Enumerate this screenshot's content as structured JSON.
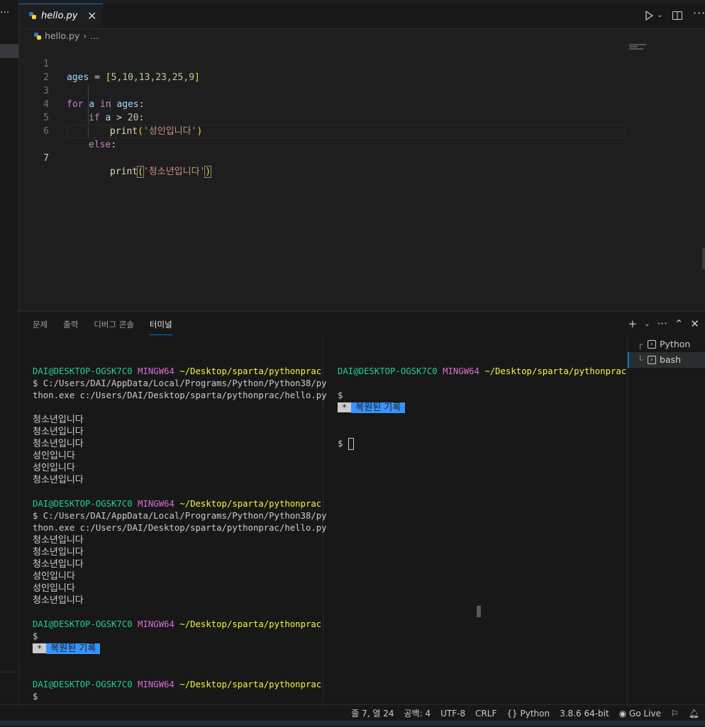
{
  "editor": {
    "tab_label": "hello.py",
    "breadcrumb_file": "hello.py",
    "breadcrumb_more": "...",
    "line_numbers": [
      "1",
      "2",
      "3",
      "4",
      "5",
      "6",
      "7"
    ],
    "code": {
      "l1_var": "ages",
      "l1_eq": " = ",
      "l1_open": "[",
      "l1_nums": "5,10,13,23,25,9",
      "l1_close": "]",
      "l3_for": "for",
      "l3_a": " a ",
      "l3_in": "in",
      "l3_ages": " ages",
      "l3_colon": ":",
      "l4_if": "if",
      "l4_a": " a ",
      "l4_gt": "> ",
      "l4_num": "20",
      "l4_colon": ":",
      "l5_print": "print",
      "l5_open": "(",
      "l5_str": "'성인입니다'",
      "l5_close": ")",
      "l6_else": "else",
      "l6_colon": ":",
      "l7_print": "print",
      "l7_open": "(",
      "l7_str": "'청소년입니다'",
      "l7_close": ")"
    }
  },
  "panel": {
    "tabs": [
      "문제",
      "출력",
      "디버그 콘솔",
      "터미널"
    ],
    "active_tab": "터미널",
    "terminals": [
      "Python",
      "bash"
    ],
    "selected_terminal": "bash"
  },
  "terminal_left": {
    "user": "DAI@DESKTOP-OGSK7C0",
    "host": "MINGW64",
    "path": "~/Desktop/sparta/pythonprac",
    "cmd1_line1": "$ C:/Users/DAI/AppData/Local/Programs/Python/Python38/py",
    "cmd1_line2": "thon.exe c:/Users/DAI/Desktop/sparta/pythonprac/hello.py",
    "output1": [
      "청소년입니다",
      "청소년입니다",
      "청소년입니다",
      "성인입니다",
      "성인입니다",
      "청소년입니다"
    ],
    "cmd2_line1": "$ C:/Users/DAI/AppData/Local/Programs/Python/Python38/py",
    "cmd2_line2": "thon.exe c:/Users/DAI/Desktop/sparta/pythonprac/hello.py",
    "output2": [
      "청소년입니다",
      "청소년입니다",
      "청소년입니다",
      "성인입니다",
      "성인입니다",
      "청소년입니다"
    ],
    "prompt": "$",
    "restored_star": "*",
    "restored_text": "복원된 기록"
  },
  "terminal_right": {
    "user": "DAI@DESKTOP-OGSK7C0",
    "host": "MINGW64",
    "path": "~/Desktop/sparta/pythonprac",
    "prompt": "$",
    "restored_star": "*",
    "restored_text": "복원된 기록"
  },
  "status_bar": {
    "position": "줄 7, 열 24",
    "indent": "공백: 4",
    "encoding": "UTF-8",
    "eol": "CRLF",
    "language": "Python",
    "interpreter": "3.8.6 64-bit",
    "go_live": "Go Live"
  },
  "colors": {
    "accent": "#0078d4",
    "prompt_user": "#23d18b",
    "prompt_host": "#d670d6",
    "prompt_path": "#f5f543",
    "restored_highlight": "#3794ff"
  }
}
